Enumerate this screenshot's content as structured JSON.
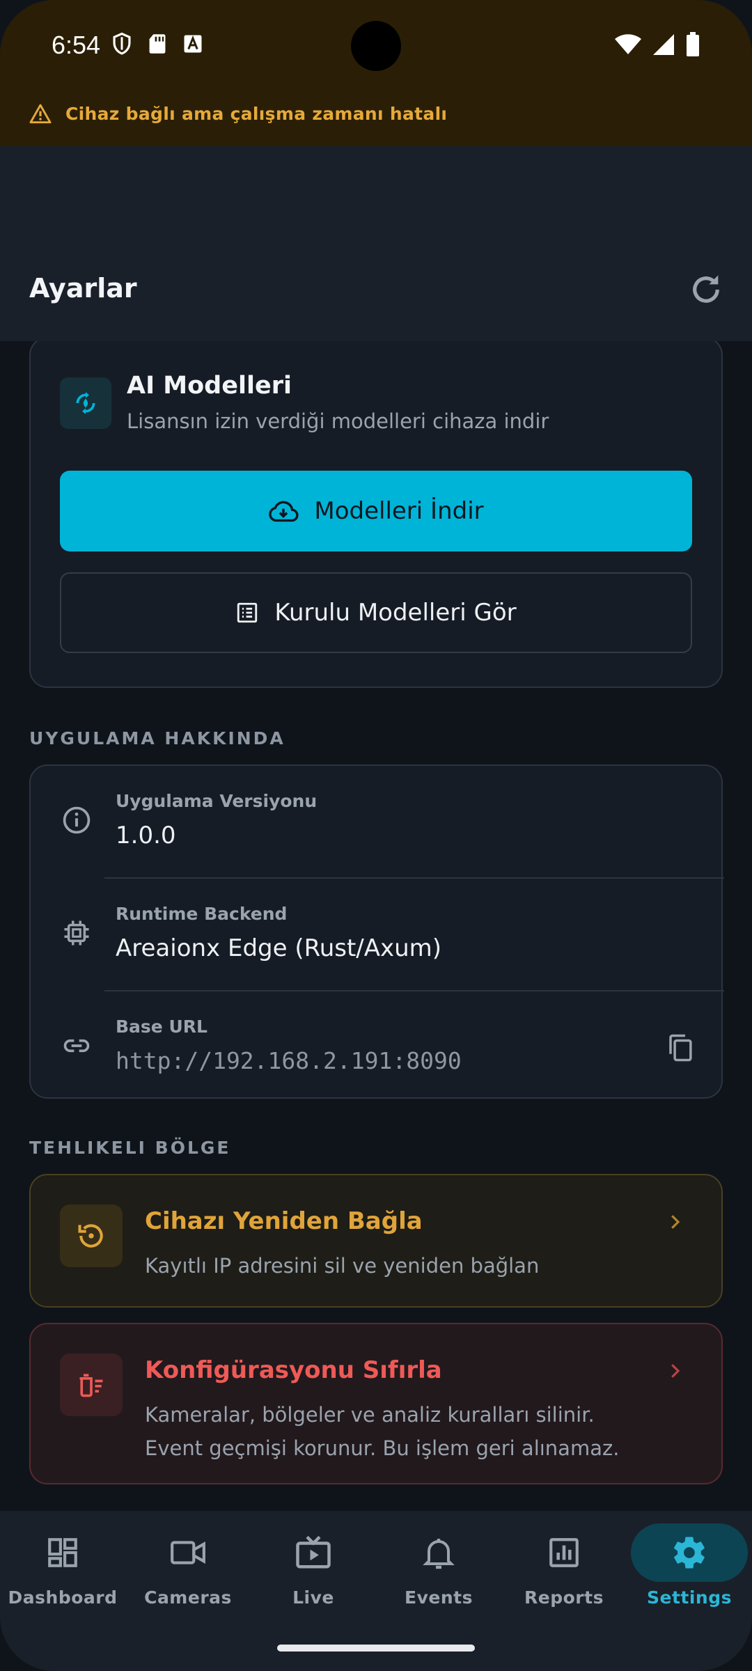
{
  "status_bar": {
    "time": "6:54"
  },
  "warning_banner": {
    "text": "Cihaz bağlı ama çalışma zamanı hatalı"
  },
  "app_bar": {
    "title": "Ayarlar"
  },
  "ai_models": {
    "title": "AI Modelleri",
    "subtitle": "Lisansın izin verdiği modelleri cihaza indir",
    "download_button": "Modelleri İndir",
    "installed_button": "Kurulu Modelleri Gör"
  },
  "about": {
    "section_title": "UYGULAMA HAKKINDA",
    "rows": [
      {
        "label": "Uygulama Versiyonu",
        "value": "1.0.0"
      },
      {
        "label": "Runtime Backend",
        "value": "Areaionx Edge (Rust/Axum)"
      },
      {
        "label": "Base URL",
        "value": "http://192.168.2.191:8090"
      }
    ]
  },
  "danger": {
    "section_title": "TEHLIKELI BÖLGE",
    "reconnect": {
      "title": "Cihazı Yeniden Bağla",
      "description": "Kayıtlı IP adresini sil ve yeniden bağlan"
    },
    "reset": {
      "title": "Konfigürasyonu Sıfırla",
      "description_line1": "Kameralar, bölgeler ve analiz kuralları silinir.",
      "description_line2": "Event geçmişi korunur. Bu işlem geri alınamaz."
    }
  },
  "bottom_nav": {
    "items": [
      {
        "label": "Dashboard",
        "icon": "dashboard-icon"
      },
      {
        "label": "Cameras",
        "icon": "camera-icon"
      },
      {
        "label": "Live",
        "icon": "live-tv-icon"
      },
      {
        "label": "Events",
        "icon": "bell-icon"
      },
      {
        "label": "Reports",
        "icon": "bar-chart-icon"
      },
      {
        "label": "Settings",
        "icon": "gear-icon"
      }
    ],
    "active": "Settings"
  },
  "colors": {
    "accent": "#00b4d8",
    "warning": "#e6a93a",
    "danger": "#ee5a56",
    "background": "#0f141b"
  }
}
